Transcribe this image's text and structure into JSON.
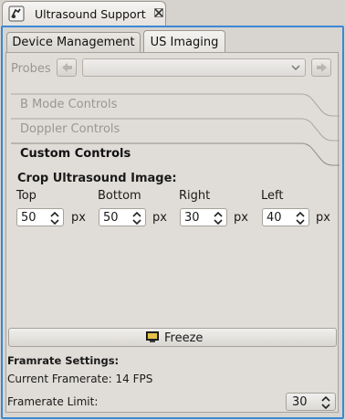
{
  "view": {
    "title": "Ultrasound Support",
    "icon": "probe-icon",
    "close_icon": "close-icon"
  },
  "tabs": [
    {
      "label": "Device Management",
      "active": false
    },
    {
      "label": "US Imaging",
      "active": true
    }
  ],
  "probes": {
    "label": "Probes",
    "selected": "",
    "enabled": false
  },
  "sections": [
    {
      "label": "B Mode Controls",
      "active": false
    },
    {
      "label": "Doppler Controls",
      "active": false
    },
    {
      "label": "Custom Controls",
      "active": true
    }
  ],
  "crop": {
    "title": "Crop Ultrasound Image:",
    "unit": "px",
    "fields": [
      {
        "label": "Top",
        "value": "50"
      },
      {
        "label": "Bottom",
        "value": "50"
      },
      {
        "label": "Right",
        "value": "30"
      },
      {
        "label": "Left",
        "value": "40"
      }
    ]
  },
  "freeze": {
    "label": "Freeze",
    "icon": "monitor-icon"
  },
  "framerate": {
    "title": "Framrate Settings:",
    "current": "Current Framerate: 14 FPS",
    "limit_label": "Framerate Limit:",
    "limit_value": "30"
  },
  "colors": {
    "focus_border": "#3b88d4",
    "background": "#d8d4cf",
    "disabled_text": "#9a968f"
  }
}
